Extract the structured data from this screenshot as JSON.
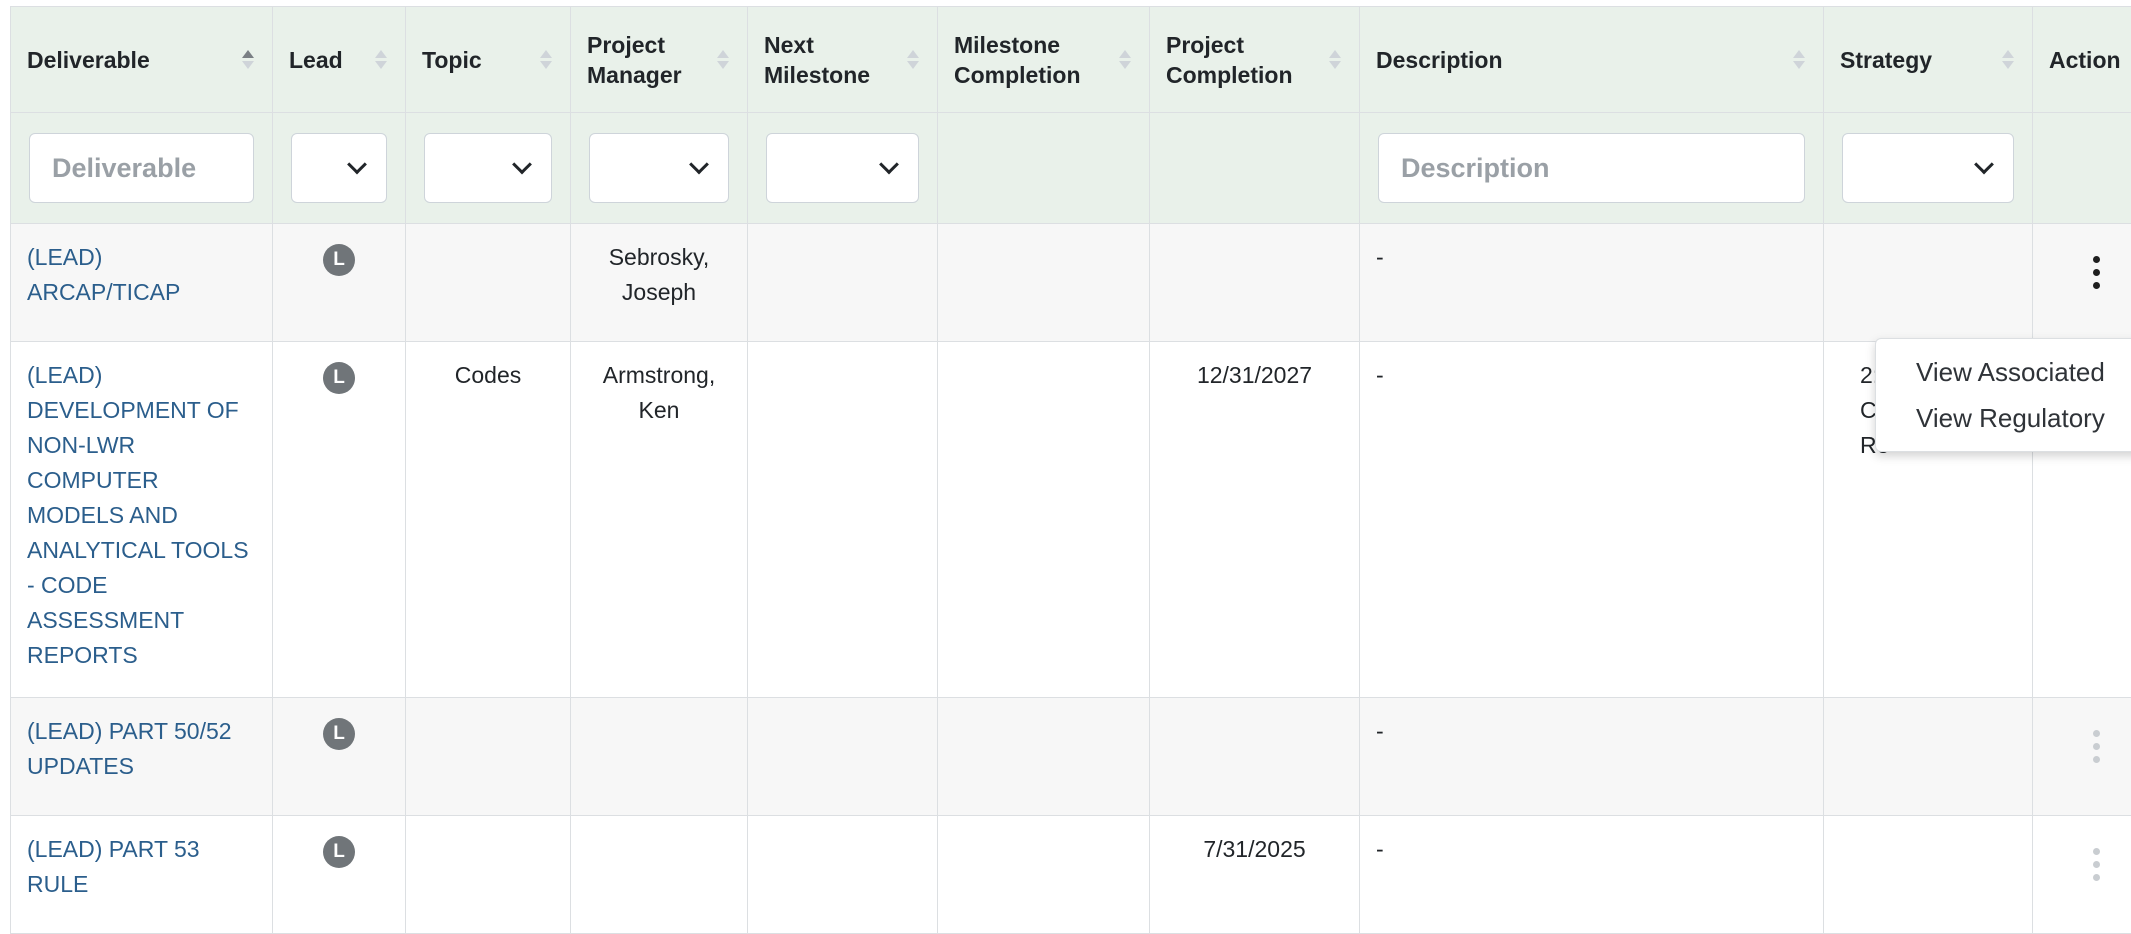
{
  "headers": [
    {
      "label": "Deliverable"
    },
    {
      "label": "Lead"
    },
    {
      "label": "Topic"
    },
    {
      "label": "Project Manager"
    },
    {
      "label": "Next Milestone"
    },
    {
      "label": "Milestone Completion"
    },
    {
      "label": "Project Completion"
    },
    {
      "label": "Description"
    },
    {
      "label": "Strategy"
    },
    {
      "label": "Action"
    }
  ],
  "filters": {
    "deliverable_placeholder": "Deliverable",
    "description_placeholder": "Description"
  },
  "rows": [
    {
      "deliverable": "(LEAD) ARCAP/TICAP",
      "lead": "L",
      "topic": "",
      "project_manager": "Sebrosky, Joseph",
      "next_milestone": "",
      "milestone_completion": "",
      "project_completion": "",
      "description": "-",
      "strategy": ""
    },
    {
      "deliverable": "(LEAD) DEVELOPMENT OF NON-LWR COMPUTER MODELS AND ANALYTICAL TOOLS - CODE ASSESSMENT REPORTS",
      "lead": "L",
      "topic": "Codes",
      "project_manager": "Armstrong, Ken",
      "next_milestone": "",
      "milestone_completion": "",
      "project_completion": "12/31/2027",
      "description": "-",
      "strategy": "2:\nC\nRe"
    },
    {
      "deliverable": "(LEAD) PART 50/52 UPDATES",
      "lead": "L",
      "topic": "",
      "project_manager": "",
      "next_milestone": "",
      "milestone_completion": "",
      "project_completion": "",
      "description": "-",
      "strategy": ""
    },
    {
      "deliverable": "(LEAD) PART 53 RULE",
      "lead": "L",
      "topic": "",
      "project_manager": "",
      "next_milestone": "",
      "milestone_completion": "",
      "project_completion": "7/31/2025",
      "description": "-",
      "strategy": ""
    }
  ],
  "action_menu": {
    "items": [
      "View Associated",
      "View Regulatory"
    ]
  },
  "colors": {
    "header_bg": "#e9f1ea",
    "link": "#2b5e8c",
    "badge": "#707579",
    "row_alt": "#f7f7f7"
  }
}
